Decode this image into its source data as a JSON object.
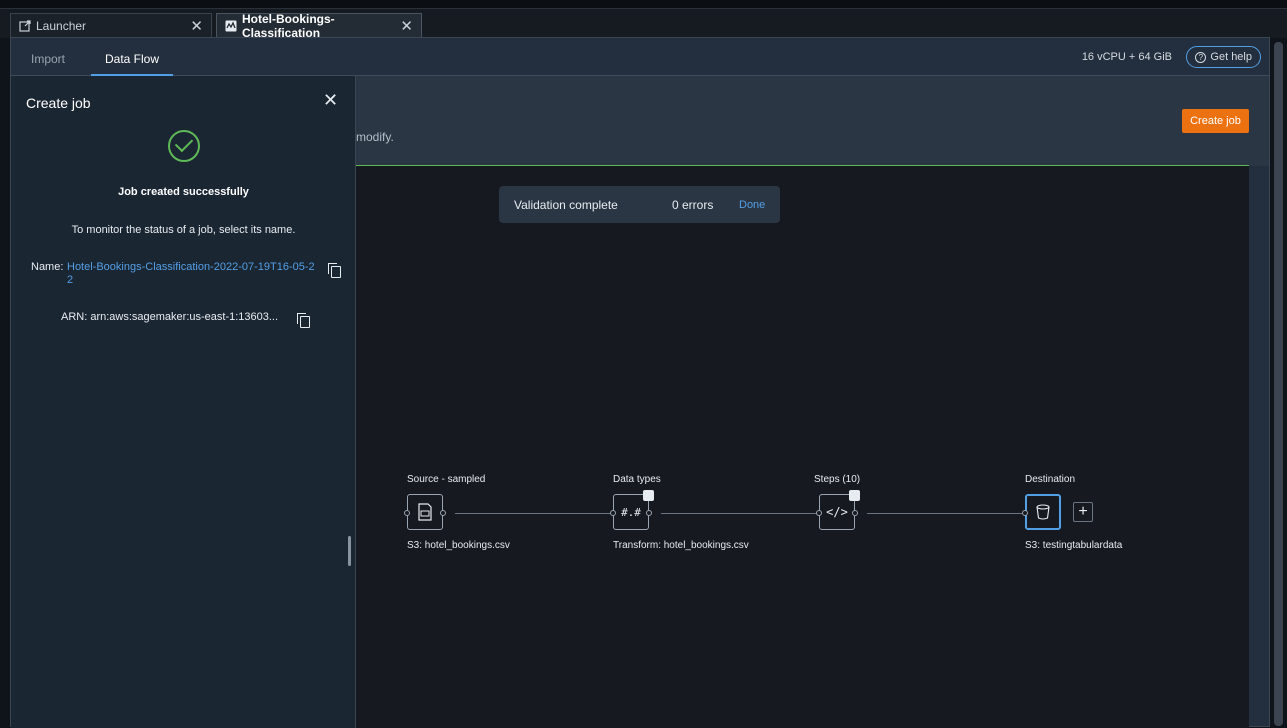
{
  "tabs": [
    {
      "label": "Launcher",
      "icon": "external-link-icon"
    },
    {
      "label": "Hotel-Bookings-Classification",
      "icon": "data-wrangler-icon"
    }
  ],
  "subtabs": [
    "Import",
    "Data Flow"
  ],
  "resources": "16 vCPU + 64 GiB",
  "help_label": "Get help",
  "header": {
    "description_tail": "modify.",
    "create_job_label": "Create job"
  },
  "toast": {
    "status": "Validation complete",
    "errors": "0 errors",
    "action": "Done"
  },
  "flow": {
    "nodes": [
      {
        "title": "Source - sampled",
        "subtitle": "S3: hotel_bookings.csv",
        "icon": "file-icon"
      },
      {
        "title": "Data types",
        "subtitle": "Transform: hotel_bookings.csv",
        "glyph": "#.#",
        "icon": "data-types-icon"
      },
      {
        "title": "Steps (10)",
        "subtitle": "",
        "glyph": "</>",
        "icon": "code-icon"
      },
      {
        "title": "Destination",
        "subtitle": "S3: testingtabulardata",
        "icon": "bucket-icon"
      }
    ],
    "add_glyph": "+"
  },
  "panel": {
    "title": "Create job",
    "close_glyph": "✕",
    "success": "Job created successfully",
    "monitor_text": "To monitor the status of a job, select its name.",
    "name_label": "Name:",
    "name_value": "Hotel-Bookings-Classification-2022-07-19T16-05-22",
    "arn_text": "ARN: arn:aws:sagemaker:us-east-1:13603..."
  },
  "colors": {
    "accent": "#539fe5",
    "success": "#5fb957",
    "primary_button": "#ec7211"
  }
}
